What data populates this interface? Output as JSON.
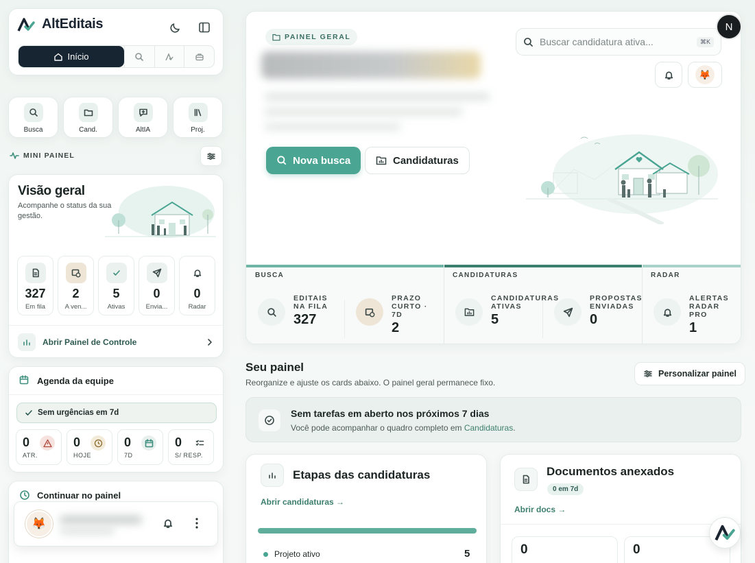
{
  "app": {
    "title": "AltEditais",
    "avatar_initial": "N"
  },
  "nav": {
    "home_label": "Início"
  },
  "quick": [
    {
      "label": "Busca",
      "icon": "search-icon"
    },
    {
      "label": "Cand.",
      "icon": "folder-icon"
    },
    {
      "label": "AltIA",
      "icon": "chat-plus-icon"
    },
    {
      "label": "Proj.",
      "icon": "books-icon"
    }
  ],
  "mini_panel": {
    "label": "MINI PAINEL"
  },
  "overview": {
    "title": "Visão geral",
    "subtitle": "Acompanhe o status da sua gestão.",
    "stats": [
      {
        "value": "327",
        "label": "Em fila",
        "icon": "document-icon"
      },
      {
        "value": "2",
        "label": "A ven...",
        "icon": "calendar-clock-icon"
      },
      {
        "value": "5",
        "label": "Ativas",
        "icon": "check-icon"
      },
      {
        "value": "0",
        "label": "Envia...",
        "icon": "send-icon"
      },
      {
        "value": "0",
        "label": "Radar",
        "icon": "bell-icon"
      }
    ],
    "open_control": "Abrir Painel de Controle"
  },
  "agenda": {
    "title": "Agenda da equipe",
    "status": "Sem urgências em 7d",
    "items": [
      {
        "value": "0",
        "label": "ATR.",
        "icon": "warning-icon",
        "color": "#f6e3e0"
      },
      {
        "value": "0",
        "label": "HOJE",
        "icon": "clock-icon",
        "color": "#f3ebd9"
      },
      {
        "value": "0",
        "label": "7D",
        "icon": "calendar-icon",
        "color": "#e7f0ed"
      },
      {
        "value": "0",
        "label": "S/ RESP.",
        "icon": "list-check-icon",
        "color": "#ffffff"
      }
    ]
  },
  "continue": {
    "title": "Continuar no painel"
  },
  "hero": {
    "pill": "PAINEL GERAL",
    "search_placeholder": "Buscar candidatura ativa...",
    "shortcut": "⌘K",
    "new_search": "Nova busca",
    "applications": "Candidaturas"
  },
  "sections": [
    {
      "name": "BUSCA",
      "color": "#6fb5a5"
    },
    {
      "name": "CANDIDATURAS",
      "color": "#3d7f6d"
    },
    {
      "name": "RADAR",
      "color": "#a9d3c9"
    }
  ],
  "kpis": [
    {
      "label": [
        "EDITAIS",
        "NA FILA"
      ],
      "value": "327",
      "icon": "search-icon"
    },
    {
      "label": [
        "PRAZO",
        "CURTO ·",
        "7D"
      ],
      "value": "2",
      "icon": "calendar-clock-icon"
    },
    {
      "label": [
        "CANDIDATURAS",
        "ATIVAS"
      ],
      "value": "5",
      "icon": "folder-icon"
    },
    {
      "label": [
        "PROPOSTAS",
        "ENVIADAS"
      ],
      "value": "0",
      "icon": "send-icon"
    },
    {
      "label": [
        "ALERTAS",
        "RADAR",
        "PRO"
      ],
      "value": "1",
      "icon": "bell-icon"
    }
  ],
  "seu_painel": {
    "title": "Seu painel",
    "subtitle": "Reorganize e ajuste os cards abaixo. O painel geral permanece fixo.",
    "customize": "Personalizar painel"
  },
  "tasks": {
    "title": "Sem tarefas em aberto nos próximos 7 dias",
    "text": "Você pode acompanhar o quadro completo em ",
    "link": "Candidaturas",
    "tail": "."
  },
  "stages": {
    "title": "Etapas das candidaturas",
    "link": "Abrir candidaturas →",
    "rows": [
      {
        "label": "Projeto ativo",
        "value": "5"
      }
    ],
    "progress": 1.0
  },
  "docs": {
    "title": "Documentos anexados",
    "badge": "0 em 7d",
    "link": "Abrir docs →",
    "values": [
      "0",
      "0"
    ]
  }
}
